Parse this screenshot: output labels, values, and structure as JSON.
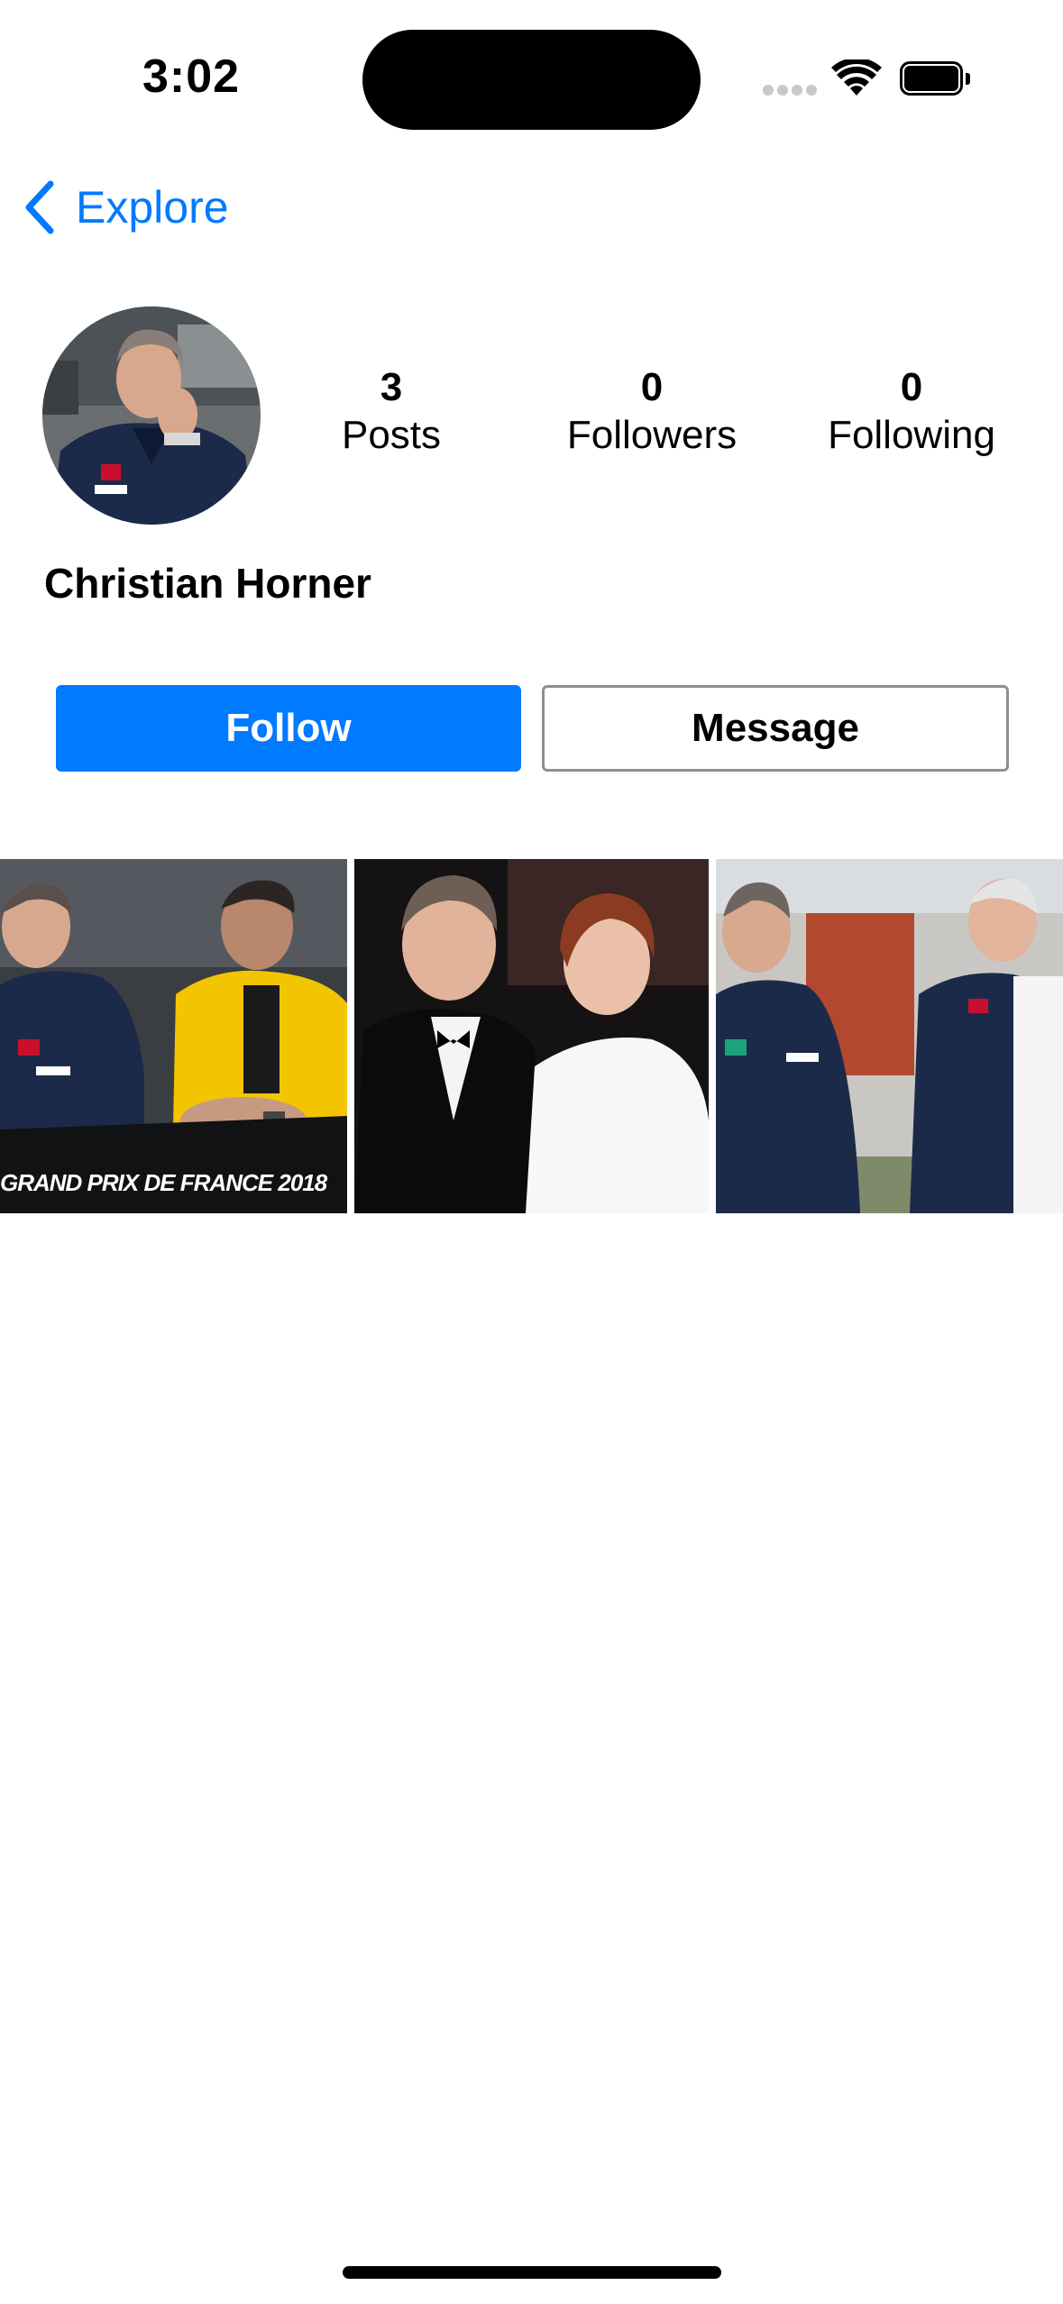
{
  "status_bar": {
    "time": "3:02",
    "icons": [
      "cellular-signal-icon",
      "wifi-icon",
      "battery-icon"
    ]
  },
  "nav": {
    "back_label": "Explore",
    "back_icon": "chevron-left-icon"
  },
  "profile": {
    "name": "Christian Horner",
    "stats": {
      "posts": {
        "count": "3",
        "label": "Posts"
      },
      "followers": {
        "count": "0",
        "label": "Followers"
      },
      "following": {
        "count": "0",
        "label": "Following"
      }
    }
  },
  "actions": {
    "follow_label": "Follow",
    "message_label": "Message"
  },
  "posts": [
    {
      "caption": "GRAND PRIX DE FRANCE 2018"
    },
    {
      "caption": ""
    },
    {
      "caption": ""
    }
  ],
  "colors": {
    "accent": "#007aff",
    "button_border": "#8e8e93",
    "background": "#ffffff"
  }
}
